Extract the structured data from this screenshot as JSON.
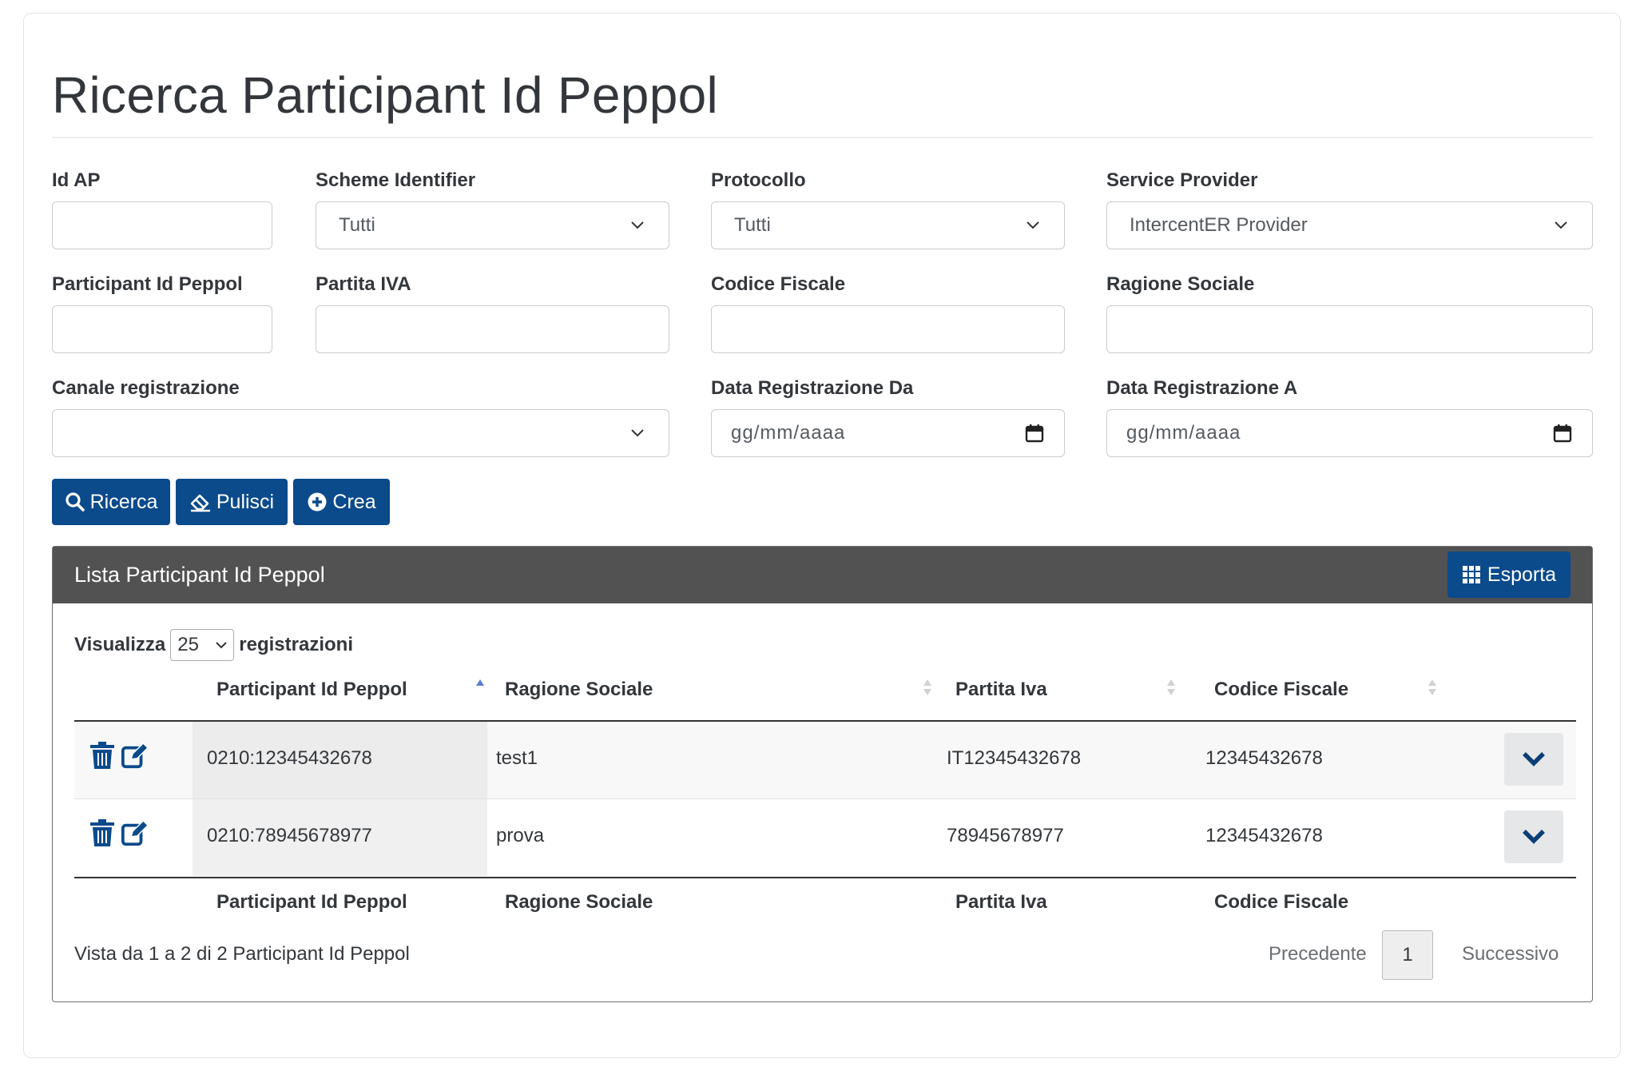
{
  "page": {
    "title": "Ricerca Participant Id Peppol"
  },
  "form": {
    "id_ap": {
      "label": "Id AP",
      "value": ""
    },
    "scheme_identifier": {
      "label": "Scheme Identifier",
      "value": "Tutti"
    },
    "protocollo": {
      "label": "Protocollo",
      "value": "Tutti"
    },
    "service_provider": {
      "label": "Service Provider",
      "value": "IntercentER Provider"
    },
    "participant_id": {
      "label": "Participant Id Peppol",
      "value": ""
    },
    "partita_iva": {
      "label": "Partita IVA",
      "value": ""
    },
    "codice_fiscale": {
      "label": "Codice Fiscale",
      "value": ""
    },
    "ragione_sociale": {
      "label": "Ragione Sociale",
      "value": ""
    },
    "canale_registrazione": {
      "label": "Canale registrazione",
      "value": ""
    },
    "data_da": {
      "label": "Data Registrazione Da",
      "placeholder": "gg/mm/aaaa"
    },
    "data_a": {
      "label": "Data Registrazione A",
      "placeholder": "gg/mm/aaaa"
    }
  },
  "actions": {
    "search": "Ricerca",
    "clear": "Pulisci",
    "create": "Crea"
  },
  "panel": {
    "title": "Lista Participant Id Peppol",
    "export": "Esporta",
    "length_prefix": "Visualizza",
    "length_value": "25",
    "length_suffix": "registrazioni"
  },
  "table": {
    "columns": [
      "Participant Id Peppol",
      "Ragione Sociale",
      "Partita Iva",
      "Codice Fiscale"
    ],
    "rows": [
      {
        "participant_id": "0210:12345432678",
        "ragione_sociale": "test1",
        "partita_iva": "IT12345432678",
        "codice_fiscale": "12345432678"
      },
      {
        "participant_id": "0210:78945678977",
        "ragione_sociale": "prova",
        "partita_iva": "78945678977",
        "codice_fiscale": "12345432678"
      }
    ],
    "info": "Vista da 1 a 2 di 2 Participant Id Peppol"
  },
  "pagination": {
    "previous": "Precedente",
    "current": "1",
    "next": "Successivo"
  },
  "icons": {
    "search": "search-icon",
    "clear": "eraser-icon",
    "create": "plus-circle-icon",
    "export": "grid-icon",
    "delete": "trash-icon",
    "edit": "edit-icon",
    "expand": "chevron-down-icon",
    "calendar": "calendar-icon"
  },
  "colors": {
    "primary": "#0b4a8b",
    "panel_header": "#525252"
  }
}
